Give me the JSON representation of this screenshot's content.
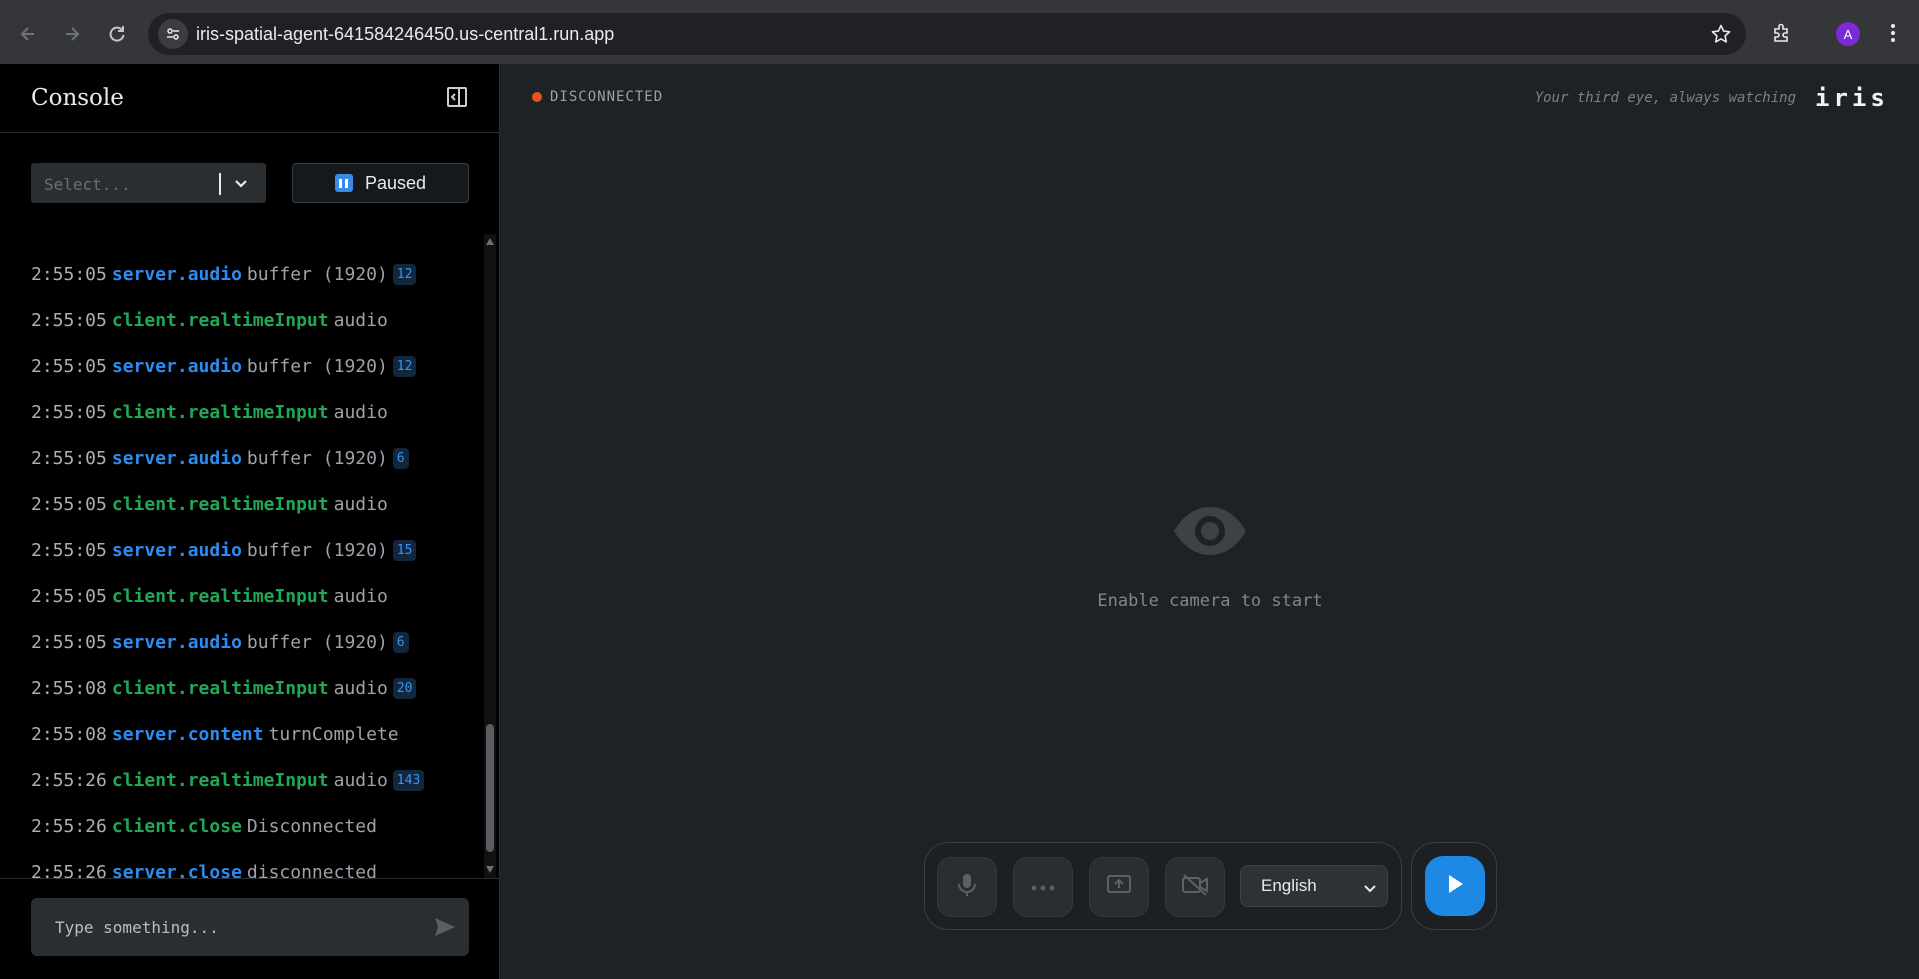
{
  "browser": {
    "url": "iris-spatial-agent-641584246450.us-central1.run.app",
    "profile_initial": "A",
    "icons": [
      "back-arrow-icon",
      "forward-arrow-icon",
      "reload-icon",
      "site-settings-icon",
      "bookmark-star-icon",
      "extensions-icon",
      "menu-dots-icon"
    ]
  },
  "sidebar": {
    "title": "Console",
    "filter_placeholder": "Select...",
    "pause_label": "Paused",
    "input_placeholder": "Type something...",
    "logs": [
      {
        "time": "2:55:05",
        "source": "server.audio",
        "type": "server",
        "message": "buffer (1920)",
        "count": "12"
      },
      {
        "time": "2:55:05",
        "source": "client.realtimeInput",
        "type": "client",
        "message": "audio",
        "count": ""
      },
      {
        "time": "2:55:05",
        "source": "server.audio",
        "type": "server",
        "message": "buffer (1920)",
        "count": "12"
      },
      {
        "time": "2:55:05",
        "source": "client.realtimeInput",
        "type": "client",
        "message": "audio",
        "count": ""
      },
      {
        "time": "2:55:05",
        "source": "server.audio",
        "type": "server",
        "message": "buffer (1920)",
        "count": "6"
      },
      {
        "time": "2:55:05",
        "source": "client.realtimeInput",
        "type": "client",
        "message": "audio",
        "count": ""
      },
      {
        "time": "2:55:05",
        "source": "server.audio",
        "type": "server",
        "message": "buffer (1920)",
        "count": "15"
      },
      {
        "time": "2:55:05",
        "source": "client.realtimeInput",
        "type": "client",
        "message": "audio",
        "count": ""
      },
      {
        "time": "2:55:05",
        "source": "server.audio",
        "type": "server",
        "message": "buffer (1920)",
        "count": "6"
      },
      {
        "time": "2:55:08",
        "source": "client.realtimeInput",
        "type": "client",
        "message": "audio",
        "count": "20"
      },
      {
        "time": "2:55:08",
        "source": "server.content",
        "type": "server",
        "message": "turnComplete",
        "count": ""
      },
      {
        "time": "2:55:26",
        "source": "client.realtimeInput",
        "type": "client",
        "message": "audio",
        "count": "143"
      },
      {
        "time": "2:55:26",
        "source": "client.close",
        "type": "client",
        "message": "Disconnected",
        "count": ""
      },
      {
        "time": "2:55:26",
        "source": "server.close",
        "type": "server",
        "message": "disconnected",
        "count": ""
      }
    ]
  },
  "main": {
    "status": "DISCONNECTED",
    "tagline": "Your third eye, always watching",
    "brand": "iris",
    "empty_state": "Enable camera to start",
    "language": "English",
    "colors": {
      "server": "#2d8cf0",
      "client": "#1fa855",
      "status_dot": "#e8541c",
      "play": "#1e88e5"
    }
  }
}
